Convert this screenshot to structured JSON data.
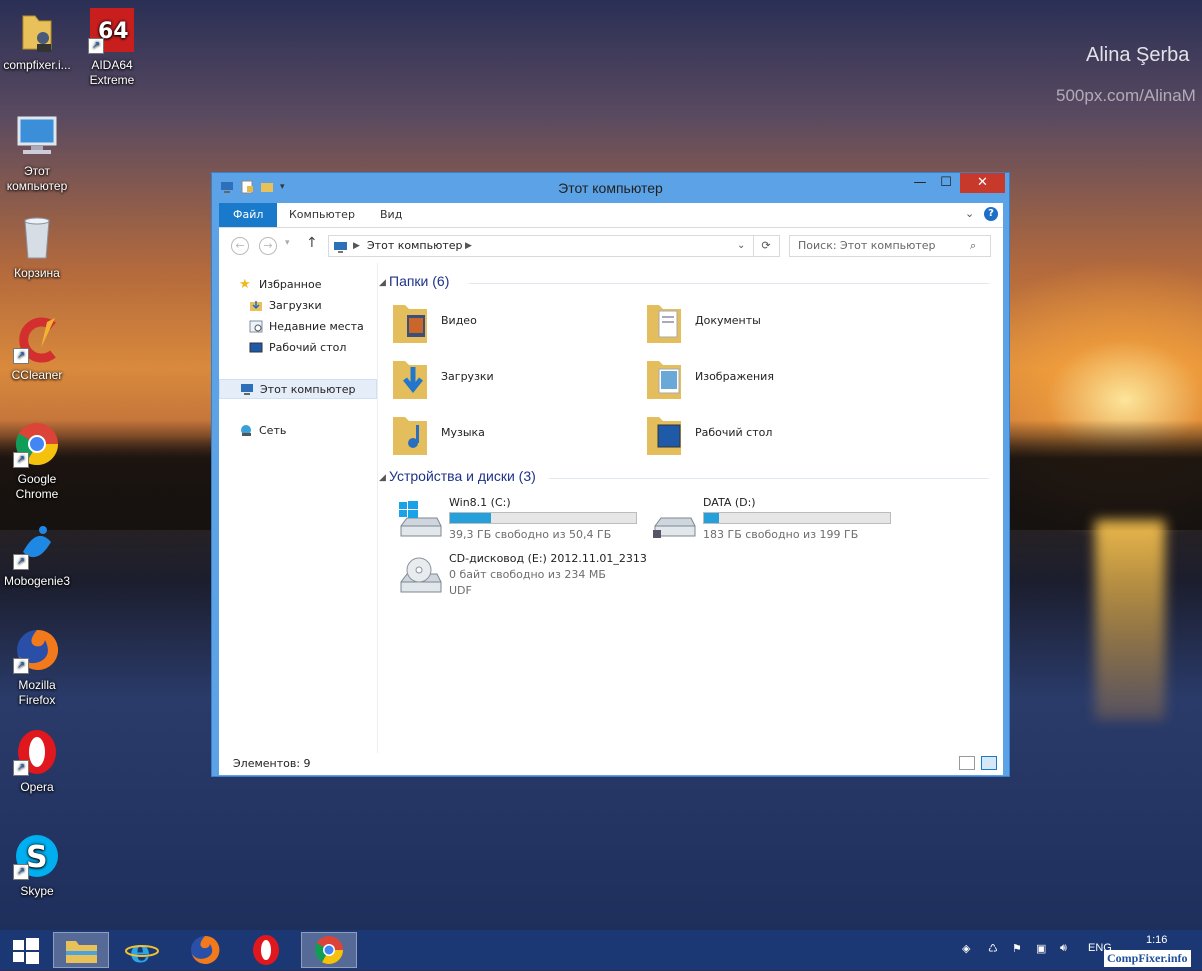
{
  "desktop": {
    "credit_name": "Alina Şerba",
    "credit_url": "500px.com/AlinaM",
    "icons": [
      {
        "label": "compfixer.i...",
        "icon": "user-folder-icon"
      },
      {
        "label": "AIDA64\nExtreme",
        "icon": "aida64-icon"
      },
      {
        "label": "Этот\nкомпьютер",
        "icon": "computer-icon"
      },
      {
        "label": "Корзина",
        "icon": "recycle-bin-icon"
      },
      {
        "label": "CCleaner",
        "icon": "ccleaner-icon"
      },
      {
        "label": "Google\nChrome",
        "icon": "chrome-icon"
      },
      {
        "label": "Mobogenie3",
        "icon": "mobogenie-icon"
      },
      {
        "label": "Mozilla\nFirefox",
        "icon": "firefox-icon"
      },
      {
        "label": "Opera",
        "icon": "opera-icon"
      },
      {
        "label": "Skype",
        "icon": "skype-icon"
      }
    ]
  },
  "window": {
    "title": "Этот компьютер",
    "controls": {
      "minimize": "—",
      "maximize": "☐",
      "close": "✕"
    },
    "ribbon": {
      "tabs": [
        "Файл",
        "Компьютер",
        "Вид"
      ],
      "active_tab": "Файл"
    },
    "address": {
      "path": "Этот компьютер",
      "search_placeholder": "Поиск: Этот компьютер"
    },
    "nav": {
      "favorites": "Избранное",
      "downloads": "Загрузки",
      "recent": "Недавние места",
      "desktop": "Рабочий стол",
      "this_pc": "Этот компьютер",
      "network": "Сеть"
    },
    "folders_group": "Папки (6)",
    "folders": [
      {
        "name": "Видео",
        "icon": "video-folder-icon"
      },
      {
        "name": "Документы",
        "icon": "documents-folder-icon"
      },
      {
        "name": "Загрузки",
        "icon": "downloads-folder-icon"
      },
      {
        "name": "Изображения",
        "icon": "pictures-folder-icon"
      },
      {
        "name": "Музыка",
        "icon": "music-folder-icon"
      },
      {
        "name": "Рабочий стол",
        "icon": "desktop-folder-icon"
      }
    ],
    "devices_group": "Устройства и диски (3)",
    "drives": [
      {
        "name": "Win8.1 (C:)",
        "info": "39,3 ГБ свободно из 50,4 ГБ",
        "used_fraction": 0.22,
        "icon": "windows-drive-icon"
      },
      {
        "name": "DATA (D:)",
        "info": "183 ГБ свободно из 199 ГБ",
        "used_fraction": 0.08,
        "icon": "hard-drive-icon"
      },
      {
        "name": "CD-дисковод (E:) 2012.11.01_2313",
        "info": "0 байт свободно из 234 МБ",
        "extra": "UDF",
        "icon": "cd-drive-icon"
      }
    ],
    "status": "Элементов: 9"
  },
  "taskbar": {
    "items": [
      "start-button",
      "explorer-icon",
      "ie-icon",
      "firefox-icon",
      "opera-icon",
      "chrome-icon"
    ],
    "lang": "ENG",
    "time": "1:16"
  },
  "watermark": "CompFixer.info",
  "colors": {
    "accent": "#1979ca",
    "drive_fill": "#26a0da",
    "window_frame": "#5ba3e6",
    "close": "#c7392b"
  }
}
